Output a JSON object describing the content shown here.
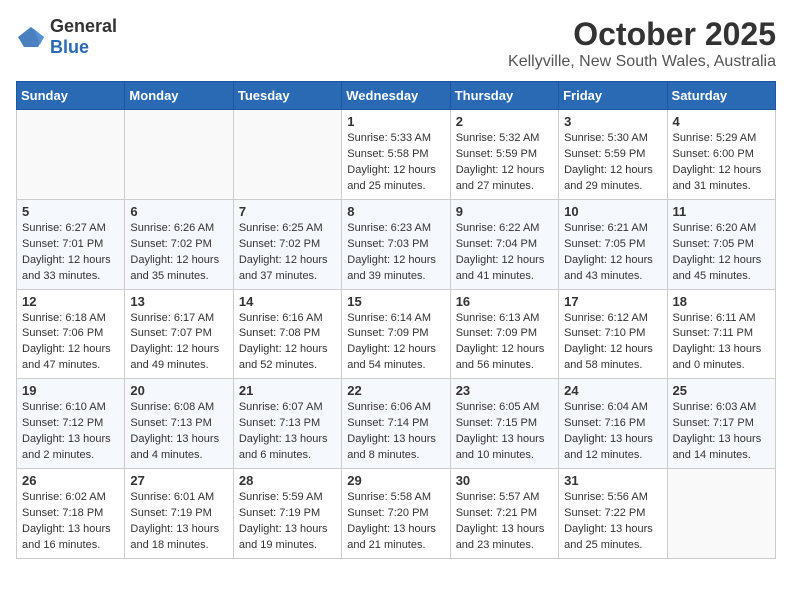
{
  "logo": {
    "general": "General",
    "blue": "Blue"
  },
  "title": "October 2025",
  "location": "Kellyville, New South Wales, Australia",
  "weekdays": [
    "Sunday",
    "Monday",
    "Tuesday",
    "Wednesday",
    "Thursday",
    "Friday",
    "Saturday"
  ],
  "weeks": [
    {
      "days": [
        {
          "num": "",
          "info": ""
        },
        {
          "num": "",
          "info": ""
        },
        {
          "num": "",
          "info": ""
        },
        {
          "num": "1",
          "info": "Sunrise: 5:33 AM\nSunset: 5:58 PM\nDaylight: 12 hours\nand 25 minutes."
        },
        {
          "num": "2",
          "info": "Sunrise: 5:32 AM\nSunset: 5:59 PM\nDaylight: 12 hours\nand 27 minutes."
        },
        {
          "num": "3",
          "info": "Sunrise: 5:30 AM\nSunset: 5:59 PM\nDaylight: 12 hours\nand 29 minutes."
        },
        {
          "num": "4",
          "info": "Sunrise: 5:29 AM\nSunset: 6:00 PM\nDaylight: 12 hours\nand 31 minutes."
        }
      ]
    },
    {
      "days": [
        {
          "num": "5",
          "info": "Sunrise: 6:27 AM\nSunset: 7:01 PM\nDaylight: 12 hours\nand 33 minutes."
        },
        {
          "num": "6",
          "info": "Sunrise: 6:26 AM\nSunset: 7:02 PM\nDaylight: 12 hours\nand 35 minutes."
        },
        {
          "num": "7",
          "info": "Sunrise: 6:25 AM\nSunset: 7:02 PM\nDaylight: 12 hours\nand 37 minutes."
        },
        {
          "num": "8",
          "info": "Sunrise: 6:23 AM\nSunset: 7:03 PM\nDaylight: 12 hours\nand 39 minutes."
        },
        {
          "num": "9",
          "info": "Sunrise: 6:22 AM\nSunset: 7:04 PM\nDaylight: 12 hours\nand 41 minutes."
        },
        {
          "num": "10",
          "info": "Sunrise: 6:21 AM\nSunset: 7:05 PM\nDaylight: 12 hours\nand 43 minutes."
        },
        {
          "num": "11",
          "info": "Sunrise: 6:20 AM\nSunset: 7:05 PM\nDaylight: 12 hours\nand 45 minutes."
        }
      ]
    },
    {
      "days": [
        {
          "num": "12",
          "info": "Sunrise: 6:18 AM\nSunset: 7:06 PM\nDaylight: 12 hours\nand 47 minutes."
        },
        {
          "num": "13",
          "info": "Sunrise: 6:17 AM\nSunset: 7:07 PM\nDaylight: 12 hours\nand 49 minutes."
        },
        {
          "num": "14",
          "info": "Sunrise: 6:16 AM\nSunset: 7:08 PM\nDaylight: 12 hours\nand 52 minutes."
        },
        {
          "num": "15",
          "info": "Sunrise: 6:14 AM\nSunset: 7:09 PM\nDaylight: 12 hours\nand 54 minutes."
        },
        {
          "num": "16",
          "info": "Sunrise: 6:13 AM\nSunset: 7:09 PM\nDaylight: 12 hours\nand 56 minutes."
        },
        {
          "num": "17",
          "info": "Sunrise: 6:12 AM\nSunset: 7:10 PM\nDaylight: 12 hours\nand 58 minutes."
        },
        {
          "num": "18",
          "info": "Sunrise: 6:11 AM\nSunset: 7:11 PM\nDaylight: 13 hours\nand 0 minutes."
        }
      ]
    },
    {
      "days": [
        {
          "num": "19",
          "info": "Sunrise: 6:10 AM\nSunset: 7:12 PM\nDaylight: 13 hours\nand 2 minutes."
        },
        {
          "num": "20",
          "info": "Sunrise: 6:08 AM\nSunset: 7:13 PM\nDaylight: 13 hours\nand 4 minutes."
        },
        {
          "num": "21",
          "info": "Sunrise: 6:07 AM\nSunset: 7:13 PM\nDaylight: 13 hours\nand 6 minutes."
        },
        {
          "num": "22",
          "info": "Sunrise: 6:06 AM\nSunset: 7:14 PM\nDaylight: 13 hours\nand 8 minutes."
        },
        {
          "num": "23",
          "info": "Sunrise: 6:05 AM\nSunset: 7:15 PM\nDaylight: 13 hours\nand 10 minutes."
        },
        {
          "num": "24",
          "info": "Sunrise: 6:04 AM\nSunset: 7:16 PM\nDaylight: 13 hours\nand 12 minutes."
        },
        {
          "num": "25",
          "info": "Sunrise: 6:03 AM\nSunset: 7:17 PM\nDaylight: 13 hours\nand 14 minutes."
        }
      ]
    },
    {
      "days": [
        {
          "num": "26",
          "info": "Sunrise: 6:02 AM\nSunset: 7:18 PM\nDaylight: 13 hours\nand 16 minutes."
        },
        {
          "num": "27",
          "info": "Sunrise: 6:01 AM\nSunset: 7:19 PM\nDaylight: 13 hours\nand 18 minutes."
        },
        {
          "num": "28",
          "info": "Sunrise: 5:59 AM\nSunset: 7:19 PM\nDaylight: 13 hours\nand 19 minutes."
        },
        {
          "num": "29",
          "info": "Sunrise: 5:58 AM\nSunset: 7:20 PM\nDaylight: 13 hours\nand 21 minutes."
        },
        {
          "num": "30",
          "info": "Sunrise: 5:57 AM\nSunset: 7:21 PM\nDaylight: 13 hours\nand 23 minutes."
        },
        {
          "num": "31",
          "info": "Sunrise: 5:56 AM\nSunset: 7:22 PM\nDaylight: 13 hours\nand 25 minutes."
        },
        {
          "num": "",
          "info": ""
        }
      ]
    }
  ]
}
